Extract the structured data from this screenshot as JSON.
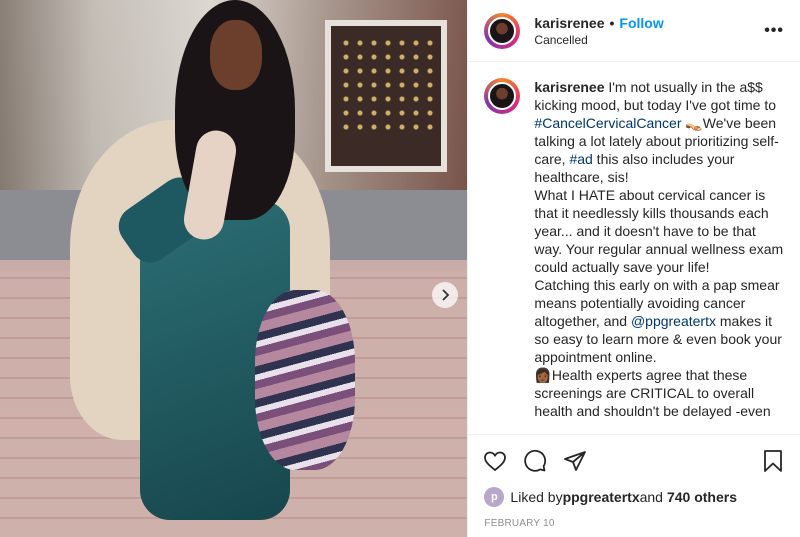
{
  "header": {
    "username": "karisrenee",
    "separator": "•",
    "follow_label": "Follow",
    "subtitle": "Cancelled",
    "more_label": "•••"
  },
  "caption": {
    "username": "karisrenee",
    "text_1": " I'm not usually in the a$$ kicking mood, but today I've got time to ",
    "hashtag_1": "#CancelCervicalCancer",
    "text_2": " 👡We've been talking a lot lately about prioritizing self-care, ",
    "hashtag_2": "#ad",
    "text_3": " this also includes your healthcare, sis!\nWhat I HATE about cervical cancer is that it needlessly kills thousands each year... and it doesn't have to be that way. Your regular annual wellness exam could actually save your life!\nCatching this early on with a pap smear means potentially avoiding cancer altogether, and ",
    "mention": "@ppgreatertx",
    "text_4": " makes it so easy to learn more & even book your appointment online.\n👩🏾Health experts agree that these screenings are CRITICAL to overall health and shouldn't be delayed -even"
  },
  "likes": {
    "prefix": "Liked by ",
    "user": "ppgreatertx",
    "middle": " and ",
    "count": "740 others",
    "avatar_letter": "p"
  },
  "date": "FEBRUARY 10",
  "colors": {
    "follow": "#0095f6",
    "hashtag": "#00376b",
    "muted": "#8e8e8e"
  },
  "icons": [
    "heart-icon",
    "comment-icon",
    "share-icon",
    "bookmark-icon",
    "chevron-right-icon",
    "more-icon"
  ]
}
